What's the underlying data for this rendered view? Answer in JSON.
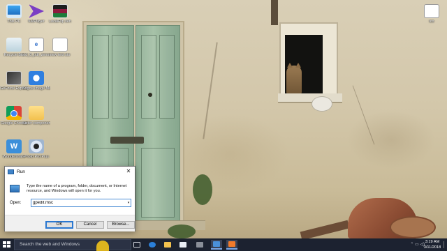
{
  "desktop": {
    "icons": [
      {
        "label": "This PC"
      },
      {
        "label": "KMPlayer"
      },
      {
        "label": "LocalFlip sen"
      },
      {
        "label": "Recycle Bin"
      },
      {
        "label": "std_8_pdf_zenode rosid text"
      },
      {
        "label": "new text sto"
      },
      {
        "label": "GeForce Experience"
      },
      {
        "label": "Sogou Image Maker"
      },
      {
        "label": "Google Chrome"
      },
      {
        "label": "Sister components"
      },
      {
        "label": "Wondershare"
      },
      {
        "label": "Photo Pro Plus"
      },
      {
        "label": "ico"
      }
    ]
  },
  "run_dialog": {
    "title": "Run",
    "close_glyph": "✕",
    "description": "Type the name of a program, folder, document, or Internet resource, and Windows will open it for you.",
    "open_label": "Open:",
    "input_value": "gpedit.msc",
    "dropdown_glyph": "▾",
    "ok_label": "OK",
    "cancel_label": "Cancel",
    "browse_label": "Browse..."
  },
  "taskbar": {
    "search_placeholder": "Search the web and Windows",
    "tray_text": "⌃  ▭  ◁)",
    "time": "3:19 AM",
    "date": "3/11/2018"
  }
}
